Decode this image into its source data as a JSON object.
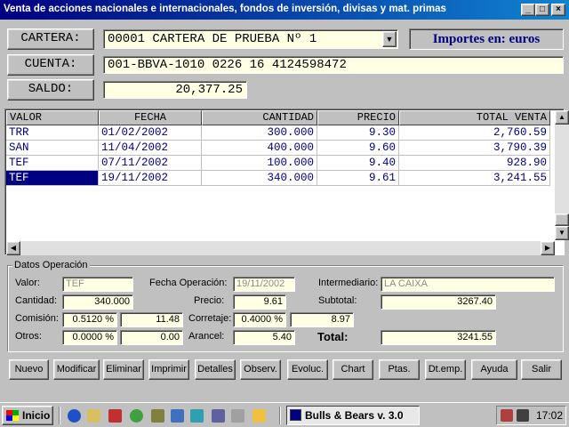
{
  "window": {
    "title": "Venta de acciones nacionales e internacionales, fondos de inversión, divisas y mat. primas",
    "minimize": "_",
    "maximize": "□",
    "close": "×"
  },
  "header": {
    "cartera_label": "CARTERA:",
    "cartera_value": "00001 CARTERA DE PRUEBA Nº 1",
    "cuenta_label": "CUENTA:",
    "cuenta_value": "001-BBVA-1010 0226 16 4124598472",
    "saldo_label": "SALDO:",
    "saldo_value": "20,377.25",
    "importes": "Importes en:  euros"
  },
  "grid": {
    "columns": [
      "VALOR",
      "FECHA",
      "CANTIDAD",
      "PRECIO",
      "TOTAL VENTA"
    ],
    "rows": [
      {
        "valor": "TRR",
        "fecha": "01/02/2002",
        "cantidad": "300.000",
        "precio": "9.30",
        "total": "2,760.59"
      },
      {
        "valor": "SAN",
        "fecha": "11/04/2002",
        "cantidad": "400.000",
        "precio": "9.60",
        "total": "3,790.39"
      },
      {
        "valor": "TEF",
        "fecha": "07/11/2002",
        "cantidad": "100.000",
        "precio": "9.40",
        "total": "928.90"
      },
      {
        "valor": "TEF",
        "fecha": "19/11/2002",
        "cantidad": "340.000",
        "precio": "9.61",
        "total": "3,241.55"
      }
    ],
    "selected_row": 3
  },
  "datos": {
    "legend": "Datos Operación",
    "valor_label": "Valor:",
    "valor": "TEF",
    "fecha_label": "Fecha Operación:",
    "fecha": "19/11/2002",
    "intermediario_label": "Intermediario:",
    "intermediario": "LA CAIXA",
    "cantidad_label": "Cantidad:",
    "cantidad": "340.000",
    "precio_label": "Precio:",
    "precio": "9.61",
    "subtotal_label": "Subtotal:",
    "subtotal": "3267.40",
    "comision_label": "Comisión:",
    "comision_pct": "0.5120 %",
    "comision": "11.48",
    "corretaje_label": "Corretaje:",
    "corretaje_pct": "0.4000 %",
    "corretaje": "8.97",
    "otros_label": "Otros:",
    "otros_pct": "0.0000 %",
    "otros": "0.00",
    "arancel_label": "Arancel:",
    "arancel": "5.40",
    "total_label": "Total:",
    "total": "3241.55"
  },
  "buttons": [
    "Nuevo",
    "Modificar",
    "Eliminar",
    "Imprimir",
    "Detalles",
    "Observ.",
    "Evoluc.",
    "Chart",
    "Ptas.",
    "Dt.emp.",
    "Ayuda",
    "Salir"
  ],
  "taskbar": {
    "start": "Inicio",
    "app": "Bulls & Bears v. 3.0",
    "clock": "17:02"
  },
  "colors": {
    "title_start": "#000080",
    "title_end": "#1084d0",
    "field_bg": "#ffffe4",
    "grid_text": "#000080",
    "selection": "#000080"
  }
}
